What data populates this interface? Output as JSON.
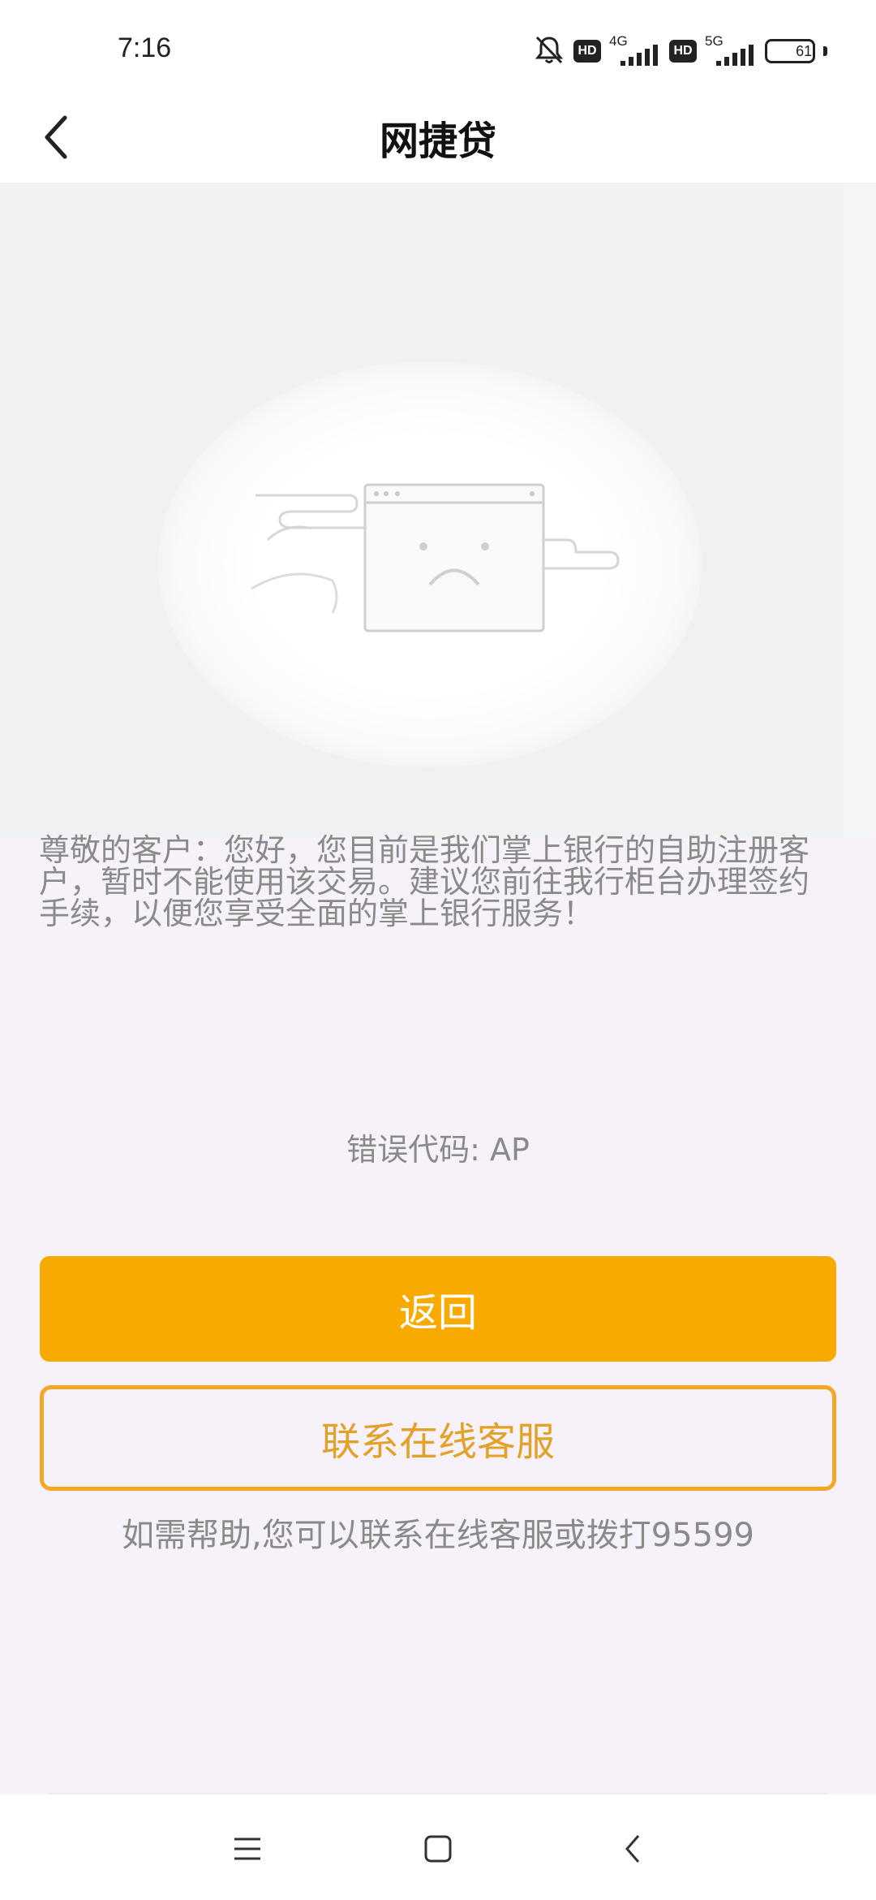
{
  "status_bar": {
    "time": "7:16",
    "hd1": "HD",
    "net1": "4G",
    "hd2": "HD",
    "net2": "5G",
    "battery": "61"
  },
  "header": {
    "title": "网捷贷"
  },
  "message": {
    "text": "尊敬的客户：您好，您目前是我们掌上银行的自助注册客户，暂时不能使用该交易。建议您前往我行柜台办理签约手续，以便您享受全面的掌上银行服务！",
    "error_code": "错误代码: AP"
  },
  "buttons": {
    "back_label": "返回",
    "service_label": "联系在线客服"
  },
  "help_text": "如需帮助,您可以联系在线客服或拨打95599",
  "colors": {
    "primary": "#f9aa00",
    "outline": "#f5a623",
    "page_bg": "#f7f1f9"
  },
  "icons": [
    "back-arrow-icon",
    "mute-bell-icon",
    "signal-icon",
    "battery-icon",
    "sad-window-icon",
    "menu-icon",
    "home-icon",
    "nav-back-icon"
  ]
}
